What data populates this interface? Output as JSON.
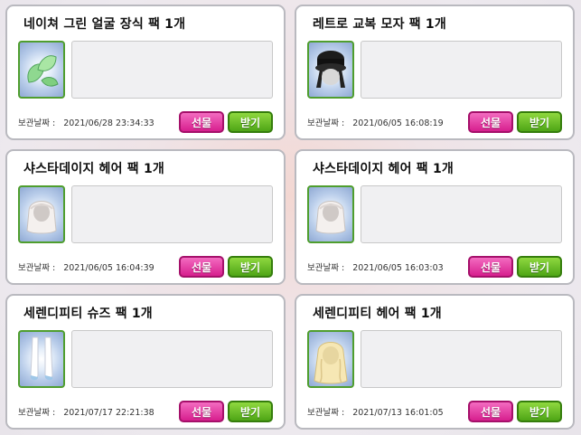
{
  "labels": {
    "storage_date_prefix": "보관날짜 :",
    "gift_button": "선물",
    "receive_button": "받기"
  },
  "items": [
    {
      "name": "네이쳐 그린 얼굴 장식 팩 1개",
      "storage_date": "2021/06/28 23:34:33",
      "icon": "green-leaf-icon"
    },
    {
      "name": "레트로 교복 모자 팩 1개",
      "storage_date": "2021/06/05 16:08:19",
      "icon": "black-hat-icon"
    },
    {
      "name": "샤스타데이지 헤어 팩 1개",
      "storage_date": "2021/06/05 16:04:39",
      "icon": "white-hair-icon"
    },
    {
      "name": "샤스타데이지 헤어 팩 1개",
      "storage_date": "2021/06/05 16:03:03",
      "icon": "white-hair-icon"
    },
    {
      "name": "세렌디피티 슈즈 팩 1개",
      "storage_date": "2021/07/17 22:21:38",
      "icon": "white-shoes-icon"
    },
    {
      "name": "세렌디피티 헤어 팩 1개",
      "storage_date": "2021/07/13 16:01:05",
      "icon": "blonde-hair-icon"
    }
  ]
}
